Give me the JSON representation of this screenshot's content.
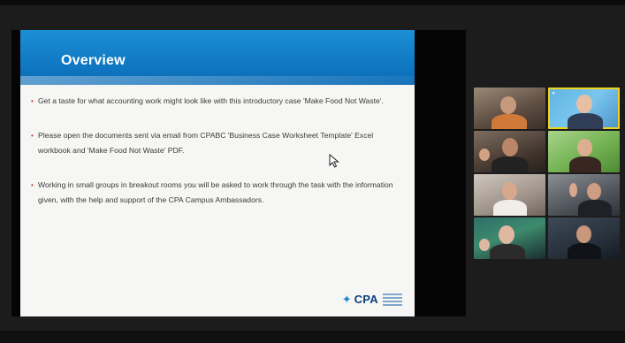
{
  "slide": {
    "title": "Overview",
    "bullets": [
      "Get a taste for what accounting work might look like with this introductory case 'Make Food Not Waste'.",
      "Please open the documents sent via email from CPABC 'Business Case Worksheet Template' Excel workbook and 'Make Food Not Waste' PDF.",
      "Working in small groups in breakout rooms you will be asked to work through the task with the information given, with the help and support of the CPA Campus Ambassadors."
    ],
    "logo_text": "CPA",
    "header_color": "#1480c8",
    "bullet_color": "#c0392b"
  },
  "gallery": {
    "participant_count": 8,
    "active_speaker_index": 1,
    "active_border_color": "#f3d21a"
  }
}
